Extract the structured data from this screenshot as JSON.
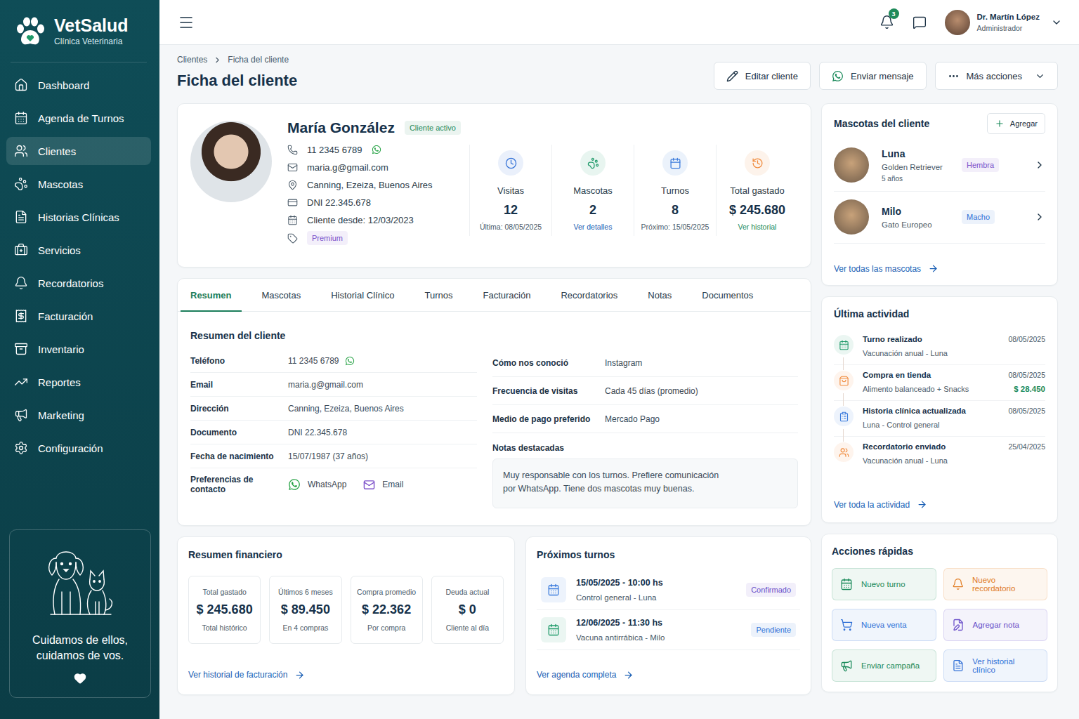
{
  "brand": {
    "name": "VetSalud",
    "subtitle": "Clínica Veterinaria"
  },
  "sidebar": {
    "items": [
      {
        "label": "Dashboard",
        "selected": false
      },
      {
        "label": "Agenda de Turnos",
        "selected": false
      },
      {
        "label": "Clientes",
        "selected": true
      },
      {
        "label": "Mascotas",
        "selected": false
      },
      {
        "label": "Historias Clínicas",
        "selected": false
      },
      {
        "label": "Servicios",
        "selected": false
      },
      {
        "label": "Recordatorios",
        "selected": false
      },
      {
        "label": "Facturación",
        "selected": false
      },
      {
        "label": "Inventario",
        "selected": false
      },
      {
        "label": "Reportes",
        "selected": false
      },
      {
        "label": "Marketing",
        "selected": false
      },
      {
        "label": "Configuración",
        "selected": false
      }
    ],
    "promo": {
      "lines": [
        "Cuidamos de ellos,",
        "cuidamos de vos."
      ]
    }
  },
  "header": {
    "notifications": "3",
    "user": {
      "name": "Dr. Martín López",
      "role": "Administrador"
    }
  },
  "breadcrumb": [
    "Clientes",
    "Ficha del cliente"
  ],
  "page_title": "Ficha del cliente",
  "actions": [
    "Editar cliente",
    "Enviar mensaje",
    "Más acciones"
  ],
  "client": {
    "name": "María González",
    "status": "Cliente activo",
    "info": [
      {
        "text": "11 2345 6789",
        "whatsapp": true
      },
      {
        "text": "maria.g@gmail.com",
        "whatsapp": false
      },
      {
        "text": "Canning, Ezeiza, Buenos Aires",
        "whatsapp": false
      },
      {
        "text": "DNI 22.345.678",
        "whatsapp": false
      },
      {
        "text": "Cliente desde: 12/03/2023",
        "whatsapp": false
      }
    ],
    "tag": "Premium"
  },
  "stats": [
    {
      "label": "Visitas",
      "value": "12",
      "sub": "Última: 08/05/2025",
      "sub_link": false,
      "sub_color": "#4a5a68",
      "color": "#2f6fd6"
    },
    {
      "label": "Mascotas",
      "value": "2",
      "sub": "Ver detalles",
      "sub_link": true,
      "sub_color": "#1a5fb4",
      "color": "#1f9a6a"
    },
    {
      "label": "Turnos",
      "value": "8",
      "sub": "Próximo: 15/05/2025",
      "sub_link": false,
      "sub_color": "#4a5a68",
      "color": "#3b7bdc"
    },
    {
      "label": "Total gastado",
      "value": "$ 245.680",
      "sub": "Ver historial",
      "sub_link": true,
      "sub_color": "#1a8a5a",
      "color": "#f08a3c"
    }
  ],
  "tabs": [
    {
      "label": "Resumen",
      "selected": true
    },
    {
      "label": "Mascotas",
      "selected": false
    },
    {
      "label": "Historial Clínico",
      "selected": false
    },
    {
      "label": "Turnos",
      "selected": false
    },
    {
      "label": "Facturación",
      "selected": false
    },
    {
      "label": "Recordatorios",
      "selected": false
    },
    {
      "label": "Notas",
      "selected": false
    },
    {
      "label": "Documentos",
      "selected": false
    }
  ],
  "summary": {
    "title": "Resumen del cliente",
    "left": [
      {
        "label": "Teléfono",
        "value": "11 2345 6789",
        "whatsapp": true
      },
      {
        "label": "Email",
        "value": "maria.g@gmail.com",
        "whatsapp": false
      },
      {
        "label": "Dirección",
        "value": "Canning, Ezeiza, Buenos Aires",
        "whatsapp": false
      },
      {
        "label": "Documento",
        "value": "DNI 22.345.678",
        "whatsapp": false
      },
      {
        "label": "Fecha de nacimiento",
        "value": "15/07/1987 (37 años)",
        "whatsapp": false
      }
    ],
    "contact": {
      "label": "Preferencias de contacto",
      "options": [
        {
          "label": "WhatsApp",
          "kind": "whatsapp"
        },
        {
          "label": "Email",
          "kind": "email"
        }
      ]
    },
    "right": [
      {
        "label": "Cómo nos conoció",
        "value": "Instagram"
      },
      {
        "label": "Frecuencia de visitas",
        "value": "Cada 45 días (promedio)"
      },
      {
        "label": "Medio de pago preferido",
        "value": "Mercado Pago"
      }
    ],
    "notes": {
      "label": "Notas destacadas",
      "text": "Muy responsable con los turnos. Prefiere comunicación por WhatsApp. Tiene dos mascotas muy buenas."
    }
  },
  "pets": {
    "title": "Mascotas del cliente",
    "add": "Agregar",
    "items": [
      {
        "name": "Luna",
        "breed": "Golden Retriever",
        "age": "5 años",
        "sex": "Hembra",
        "color": "#7b4fc9"
      },
      {
        "name": "Milo",
        "breed": "Gato Europeo",
        "sex": "Macho",
        "color": "#2f6fd6"
      }
    ],
    "link": "Ver todas las mascotas"
  },
  "activity": {
    "title": "Última actividad",
    "items": [
      {
        "title": "Turno realizado",
        "detail": "Vacunación anual - Luna",
        "date": "08/05/2025",
        "color": "#1f9a6a"
      },
      {
        "title": "Compra en tienda",
        "detail": "Alimento balanceado + Snacks",
        "date": "08/05/2025",
        "amount": "$ 28.450",
        "color": "#f08a3c"
      },
      {
        "title": "Historia clínica actualizada",
        "detail": "Luna - Control general",
        "date": "08/05/2025",
        "color": "#3b7bdc"
      },
      {
        "title": "Recordatorio enviado",
        "detail": "Vacunación anual - Luna",
        "date": "25/04/2025",
        "color": "#f08a3c"
      }
    ],
    "link": "Ver toda la actividad"
  },
  "finance": {
    "title": "Resumen financiero",
    "cards": [
      {
        "label": "Total gastado",
        "value": "$ 245.680",
        "sub": "Total histórico"
      },
      {
        "label": "Últimos 6 meses",
        "value": "$ 89.450",
        "sub": "En 4 compras"
      },
      {
        "label": "Compra promedio",
        "value": "$ 22.362",
        "sub": "Por compra"
      },
      {
        "label": "Deuda actual",
        "value": "$ 0",
        "sub": "Cliente al día"
      }
    ],
    "link": "Ver historial de facturación"
  },
  "appointments": {
    "title": "Próximos turnos",
    "items": [
      {
        "datetime": "15/05/2025 - 10:00 hs",
        "detail": "Control general - Luna",
        "status": "Confirmado",
        "status_color": "#6a4fc9",
        "color": "#3b7bdc"
      },
      {
        "datetime": "12/06/2025 - 11:30 hs",
        "detail": "Vacuna antirrábica - Milo",
        "status": "Pendiente",
        "status_color": "#2f6fd6",
        "color": "#1f9a6a"
      }
    ],
    "link": "Ver agenda completa"
  },
  "quick_actions": {
    "title": "Acciones rápidas",
    "items": [
      {
        "label": "Nuevo turno",
        "color": "#1a8a5a"
      },
      {
        "label": "Nuevo recordatorio",
        "color": "#e07a1f"
      },
      {
        "label": "Nueva venta",
        "color": "#2f6fd6"
      },
      {
        "label": "Agregar nota",
        "color": "#6a4fc9"
      },
      {
        "label": "Enviar campaña",
        "color": "#1a8a5a"
      },
      {
        "label": "Ver historial clínico",
        "color": "#2f6fd6"
      }
    ]
  }
}
